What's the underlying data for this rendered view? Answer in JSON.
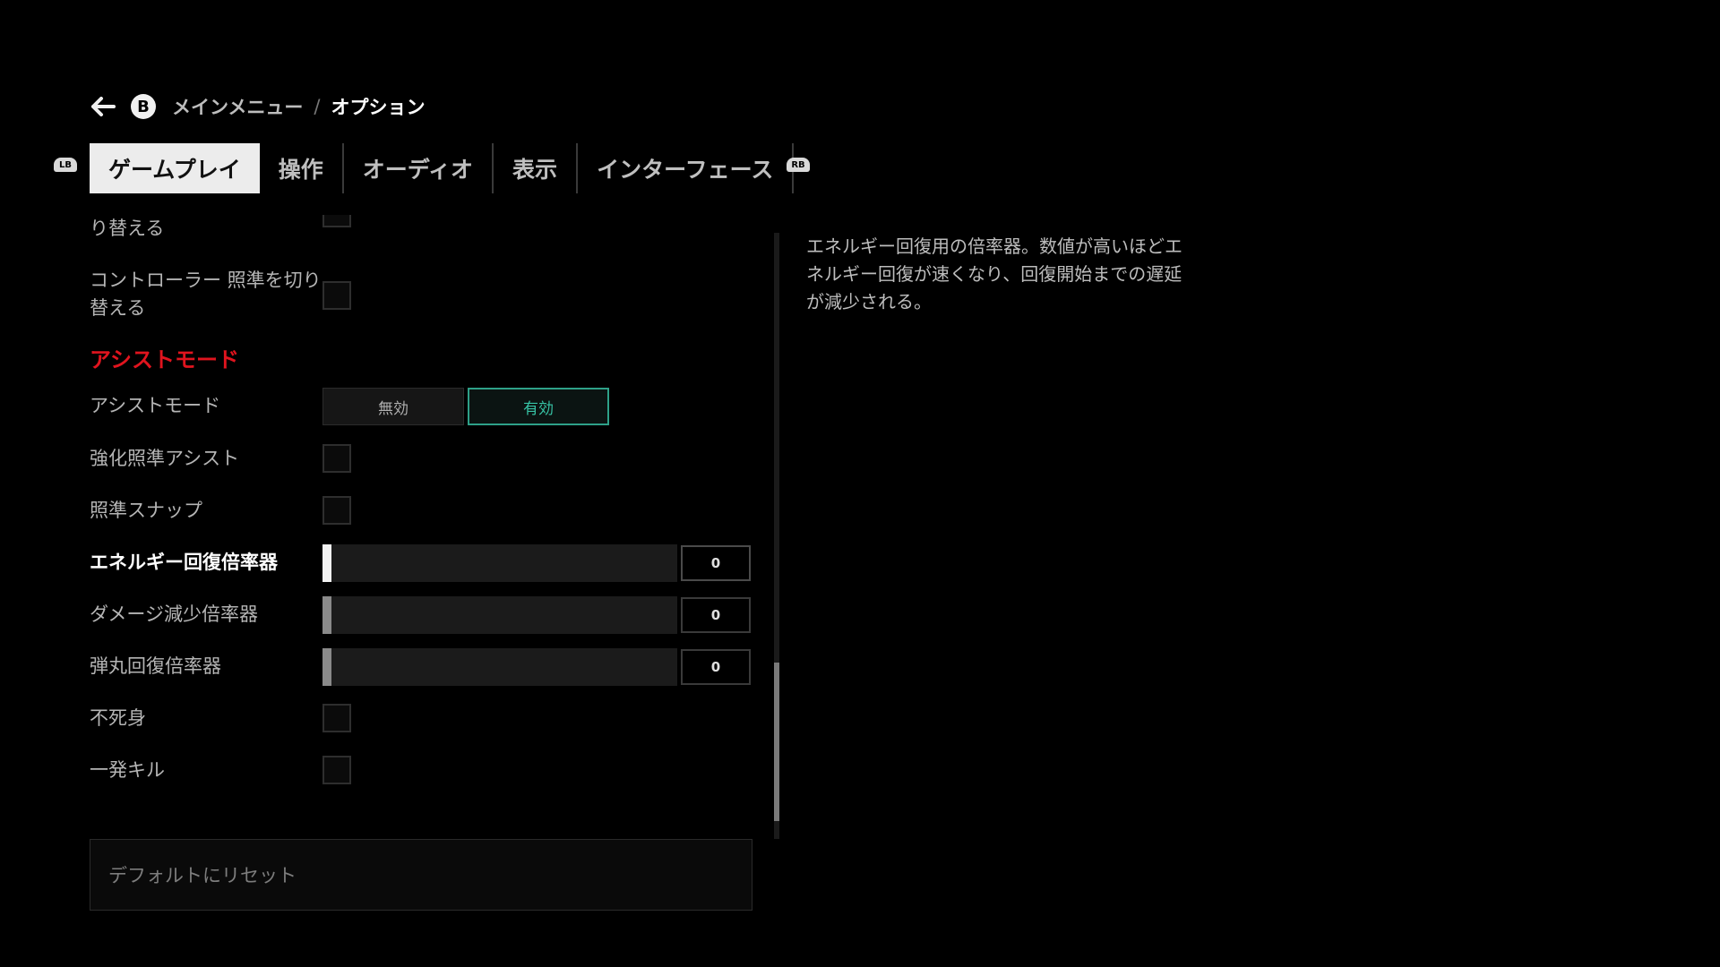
{
  "breadcrumb": {
    "parent": "メインメニュー",
    "separator": "/",
    "current": "オプション",
    "back_badge": "B"
  },
  "bumpers": {
    "left": "LB",
    "right": "RB"
  },
  "tabs": [
    {
      "label": "ゲームプレイ",
      "active": true
    },
    {
      "label": "操作",
      "active": false
    },
    {
      "label": "オーディオ",
      "active": false
    },
    {
      "label": "表示",
      "active": false
    },
    {
      "label": "インターフェース",
      "active": false
    }
  ],
  "settings": {
    "partial_label": "り替える",
    "controller_aim_toggle": {
      "label": "コントローラー 照準を切り替える",
      "checked": false
    },
    "section_assist": "アシストモード",
    "assist_mode": {
      "label": "アシストモード",
      "options": [
        "無効",
        "有効"
      ],
      "selected": "有効"
    },
    "enhanced_aim_assist": {
      "label": "強化照準アシスト",
      "checked": false
    },
    "aim_snap": {
      "label": "照準スナップ",
      "checked": false
    },
    "energy_regen": {
      "label": "エネルギー回復倍率器",
      "value": "0"
    },
    "damage_reduction": {
      "label": "ダメージ減少倍率器",
      "value": "0"
    },
    "ammo_regen": {
      "label": "弾丸回復倍率器",
      "value": "0"
    },
    "invincible": {
      "label": "不死身",
      "checked": false
    },
    "one_hit_kill": {
      "label": "一発キル",
      "checked": false
    }
  },
  "reset_button": "デフォルトにリセット",
  "description": "エネルギー回復用の倍率器。数値が高いほどエネルギー回復が速くなり、回復開始までの遅延が減少される。",
  "colors": {
    "accent_red": "#e0141e",
    "toggle_on": "#37c3a5",
    "active_tab_bg": "#ececec"
  }
}
